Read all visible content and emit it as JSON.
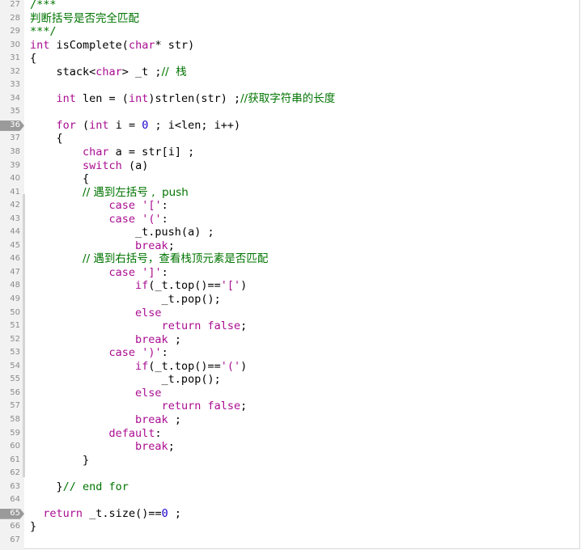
{
  "editor": {
    "lines": [
      {
        "n": "27",
        "mark": false,
        "segs": [
          {
            "t": "/***",
            "c": "c"
          }
        ]
      },
      {
        "n": "28",
        "mark": false,
        "segs": [
          {
            "t": "判断括号是否完全匹配",
            "c": "c"
          }
        ]
      },
      {
        "n": "29",
        "mark": false,
        "segs": [
          {
            "t": "***/",
            "c": "c"
          }
        ]
      },
      {
        "n": "30",
        "mark": false,
        "segs": [
          {
            "t": "int",
            "c": "k"
          },
          {
            "t": " isComplete(",
            "c": ""
          },
          {
            "t": "char",
            "c": "k"
          },
          {
            "t": "* str)",
            "c": ""
          }
        ]
      },
      {
        "n": "31",
        "mark": false,
        "segs": [
          {
            "t": "{",
            "c": ""
          }
        ]
      },
      {
        "n": "32",
        "mark": false,
        "segs": [
          {
            "t": "    stack<",
            "c": ""
          },
          {
            "t": "char",
            "c": "k"
          },
          {
            "t": "> _t ;",
            "c": ""
          },
          {
            "t": "//  栈",
            "c": "c"
          }
        ]
      },
      {
        "n": "33",
        "mark": false,
        "segs": []
      },
      {
        "n": "34",
        "mark": false,
        "segs": [
          {
            "t": "    ",
            "c": ""
          },
          {
            "t": "int",
            "c": "k"
          },
          {
            "t": " len = (",
            "c": ""
          },
          {
            "t": "int",
            "c": "k"
          },
          {
            "t": ")strlen(str) ;",
            "c": ""
          },
          {
            "t": "//获取字符串的长度",
            "c": "c"
          }
        ]
      },
      {
        "n": "35",
        "mark": false,
        "segs": []
      },
      {
        "n": "36",
        "mark": true,
        "segs": [
          {
            "t": "    ",
            "c": ""
          },
          {
            "t": "for",
            "c": "k"
          },
          {
            "t": " (",
            "c": ""
          },
          {
            "t": "int",
            "c": "k"
          },
          {
            "t": " i = ",
            "c": ""
          },
          {
            "t": "0",
            "c": "n"
          },
          {
            "t": " ; i<len; i++)",
            "c": ""
          }
        ]
      },
      {
        "n": "37",
        "mark": false,
        "segs": [
          {
            "t": "    {",
            "c": ""
          }
        ]
      },
      {
        "n": "38",
        "mark": false,
        "segs": [
          {
            "t": "        ",
            "c": ""
          },
          {
            "t": "char",
            "c": "k"
          },
          {
            "t": " a = str[i] ;",
            "c": ""
          }
        ]
      },
      {
        "n": "39",
        "mark": false,
        "segs": [
          {
            "t": "        ",
            "c": ""
          },
          {
            "t": "switch",
            "c": "k"
          },
          {
            "t": " (a)",
            "c": ""
          }
        ]
      },
      {
        "n": "40",
        "mark": false,
        "segs": [
          {
            "t": "        {",
            "c": ""
          }
        ]
      },
      {
        "n": "41",
        "mark": false,
        "segs": [
          {
            "t": "        ",
            "c": ""
          },
          {
            "t": "// 遇到左括号 ,  push",
            "c": "c"
          }
        ]
      },
      {
        "n": "42",
        "mark": false,
        "segs": [
          {
            "t": "            ",
            "c": ""
          },
          {
            "t": "case",
            "c": "k"
          },
          {
            "t": " ",
            "c": ""
          },
          {
            "t": "'['",
            "c": "k"
          },
          {
            "t": ":",
            "c": ""
          }
        ]
      },
      {
        "n": "43",
        "mark": false,
        "segs": [
          {
            "t": "            ",
            "c": ""
          },
          {
            "t": "case",
            "c": "k"
          },
          {
            "t": " ",
            "c": ""
          },
          {
            "t": "'('",
            "c": "k"
          },
          {
            "t": ":",
            "c": ""
          }
        ]
      },
      {
        "n": "44",
        "mark": false,
        "segs": [
          {
            "t": "                _t.push(a) ;",
            "c": ""
          }
        ]
      },
      {
        "n": "45",
        "mark": false,
        "segs": [
          {
            "t": "                ",
            "c": ""
          },
          {
            "t": "break",
            "c": "k"
          },
          {
            "t": ";",
            "c": ""
          }
        ]
      },
      {
        "n": "46",
        "mark": false,
        "segs": [
          {
            "t": "        ",
            "c": ""
          },
          {
            "t": "// 遇到右括号，查看栈顶元素是否匹配",
            "c": "c"
          }
        ]
      },
      {
        "n": "47",
        "mark": false,
        "segs": [
          {
            "t": "            ",
            "c": ""
          },
          {
            "t": "case",
            "c": "k"
          },
          {
            "t": " ",
            "c": ""
          },
          {
            "t": "']'",
            "c": "k"
          },
          {
            "t": ":",
            "c": ""
          }
        ]
      },
      {
        "n": "48",
        "mark": false,
        "segs": [
          {
            "t": "                ",
            "c": ""
          },
          {
            "t": "if",
            "c": "k"
          },
          {
            "t": "(_t.top()==",
            "c": ""
          },
          {
            "t": "'['",
            "c": "k"
          },
          {
            "t": ")",
            "c": ""
          }
        ]
      },
      {
        "n": "49",
        "mark": false,
        "segs": [
          {
            "t": "                    _t.pop();",
            "c": ""
          }
        ]
      },
      {
        "n": "50",
        "mark": false,
        "segs": [
          {
            "t": "                ",
            "c": ""
          },
          {
            "t": "else",
            "c": "k"
          }
        ]
      },
      {
        "n": "51",
        "mark": false,
        "segs": [
          {
            "t": "                    ",
            "c": ""
          },
          {
            "t": "return",
            "c": "k"
          },
          {
            "t": " ",
            "c": ""
          },
          {
            "t": "false",
            "c": "k"
          },
          {
            "t": ";",
            "c": ""
          }
        ]
      },
      {
        "n": "52",
        "mark": false,
        "segs": [
          {
            "t": "                ",
            "c": ""
          },
          {
            "t": "break",
            "c": "k"
          },
          {
            "t": " ;",
            "c": ""
          }
        ]
      },
      {
        "n": "53",
        "mark": false,
        "segs": [
          {
            "t": "            ",
            "c": ""
          },
          {
            "t": "case",
            "c": "k"
          },
          {
            "t": " ",
            "c": ""
          },
          {
            "t": "')'",
            "c": "k"
          },
          {
            "t": ":",
            "c": ""
          }
        ]
      },
      {
        "n": "54",
        "mark": false,
        "segs": [
          {
            "t": "                ",
            "c": ""
          },
          {
            "t": "if",
            "c": "k"
          },
          {
            "t": "(_t.top()==",
            "c": ""
          },
          {
            "t": "'('",
            "c": "k"
          },
          {
            "t": ")",
            "c": ""
          }
        ]
      },
      {
        "n": "55",
        "mark": false,
        "segs": [
          {
            "t": "                    _t.pop();",
            "c": ""
          }
        ]
      },
      {
        "n": "56",
        "mark": false,
        "segs": [
          {
            "t": "                ",
            "c": ""
          },
          {
            "t": "else",
            "c": "k"
          }
        ]
      },
      {
        "n": "57",
        "mark": false,
        "segs": [
          {
            "t": "                    ",
            "c": ""
          },
          {
            "t": "return",
            "c": "k"
          },
          {
            "t": " ",
            "c": ""
          },
          {
            "t": "false",
            "c": "k"
          },
          {
            "t": ";",
            "c": ""
          }
        ]
      },
      {
        "n": "58",
        "mark": false,
        "segs": [
          {
            "t": "                ",
            "c": ""
          },
          {
            "t": "break",
            "c": "k"
          },
          {
            "t": " ;",
            "c": ""
          }
        ]
      },
      {
        "n": "59",
        "mark": false,
        "segs": [
          {
            "t": "            ",
            "c": ""
          },
          {
            "t": "default",
            "c": "k"
          },
          {
            "t": ":",
            "c": ""
          }
        ]
      },
      {
        "n": "60",
        "mark": false,
        "segs": [
          {
            "t": "                ",
            "c": ""
          },
          {
            "t": "break",
            "c": "k"
          },
          {
            "t": ";",
            "c": ""
          }
        ]
      },
      {
        "n": "61",
        "mark": false,
        "segs": [
          {
            "t": "        }",
            "c": ""
          }
        ]
      },
      {
        "n": "62",
        "mark": false,
        "segs": []
      },
      {
        "n": "63",
        "mark": false,
        "segs": [
          {
            "t": "    }",
            "c": ""
          },
          {
            "t": "// end for",
            "c": "c"
          }
        ]
      },
      {
        "n": "64",
        "mark": false,
        "segs": []
      },
      {
        "n": "65",
        "mark": true,
        "segs": [
          {
            "t": "  ",
            "c": ""
          },
          {
            "t": "return",
            "c": "k"
          },
          {
            "t": " _t.size()==",
            "c": ""
          },
          {
            "t": "0",
            "c": "n"
          },
          {
            "t": " ;",
            "c": ""
          }
        ]
      },
      {
        "n": "66",
        "mark": false,
        "segs": [
          {
            "t": "}",
            "c": ""
          }
        ]
      },
      {
        "n": "67",
        "mark": false,
        "segs": []
      }
    ]
  },
  "colors": {
    "keyword": "#aa0d91",
    "number": "#1c00cf",
    "comment": "#007400",
    "text": "#000000",
    "gutter": "#f2f2f2",
    "line_number": "#8b8b8b",
    "breakpoint": "#9a9a9a"
  }
}
